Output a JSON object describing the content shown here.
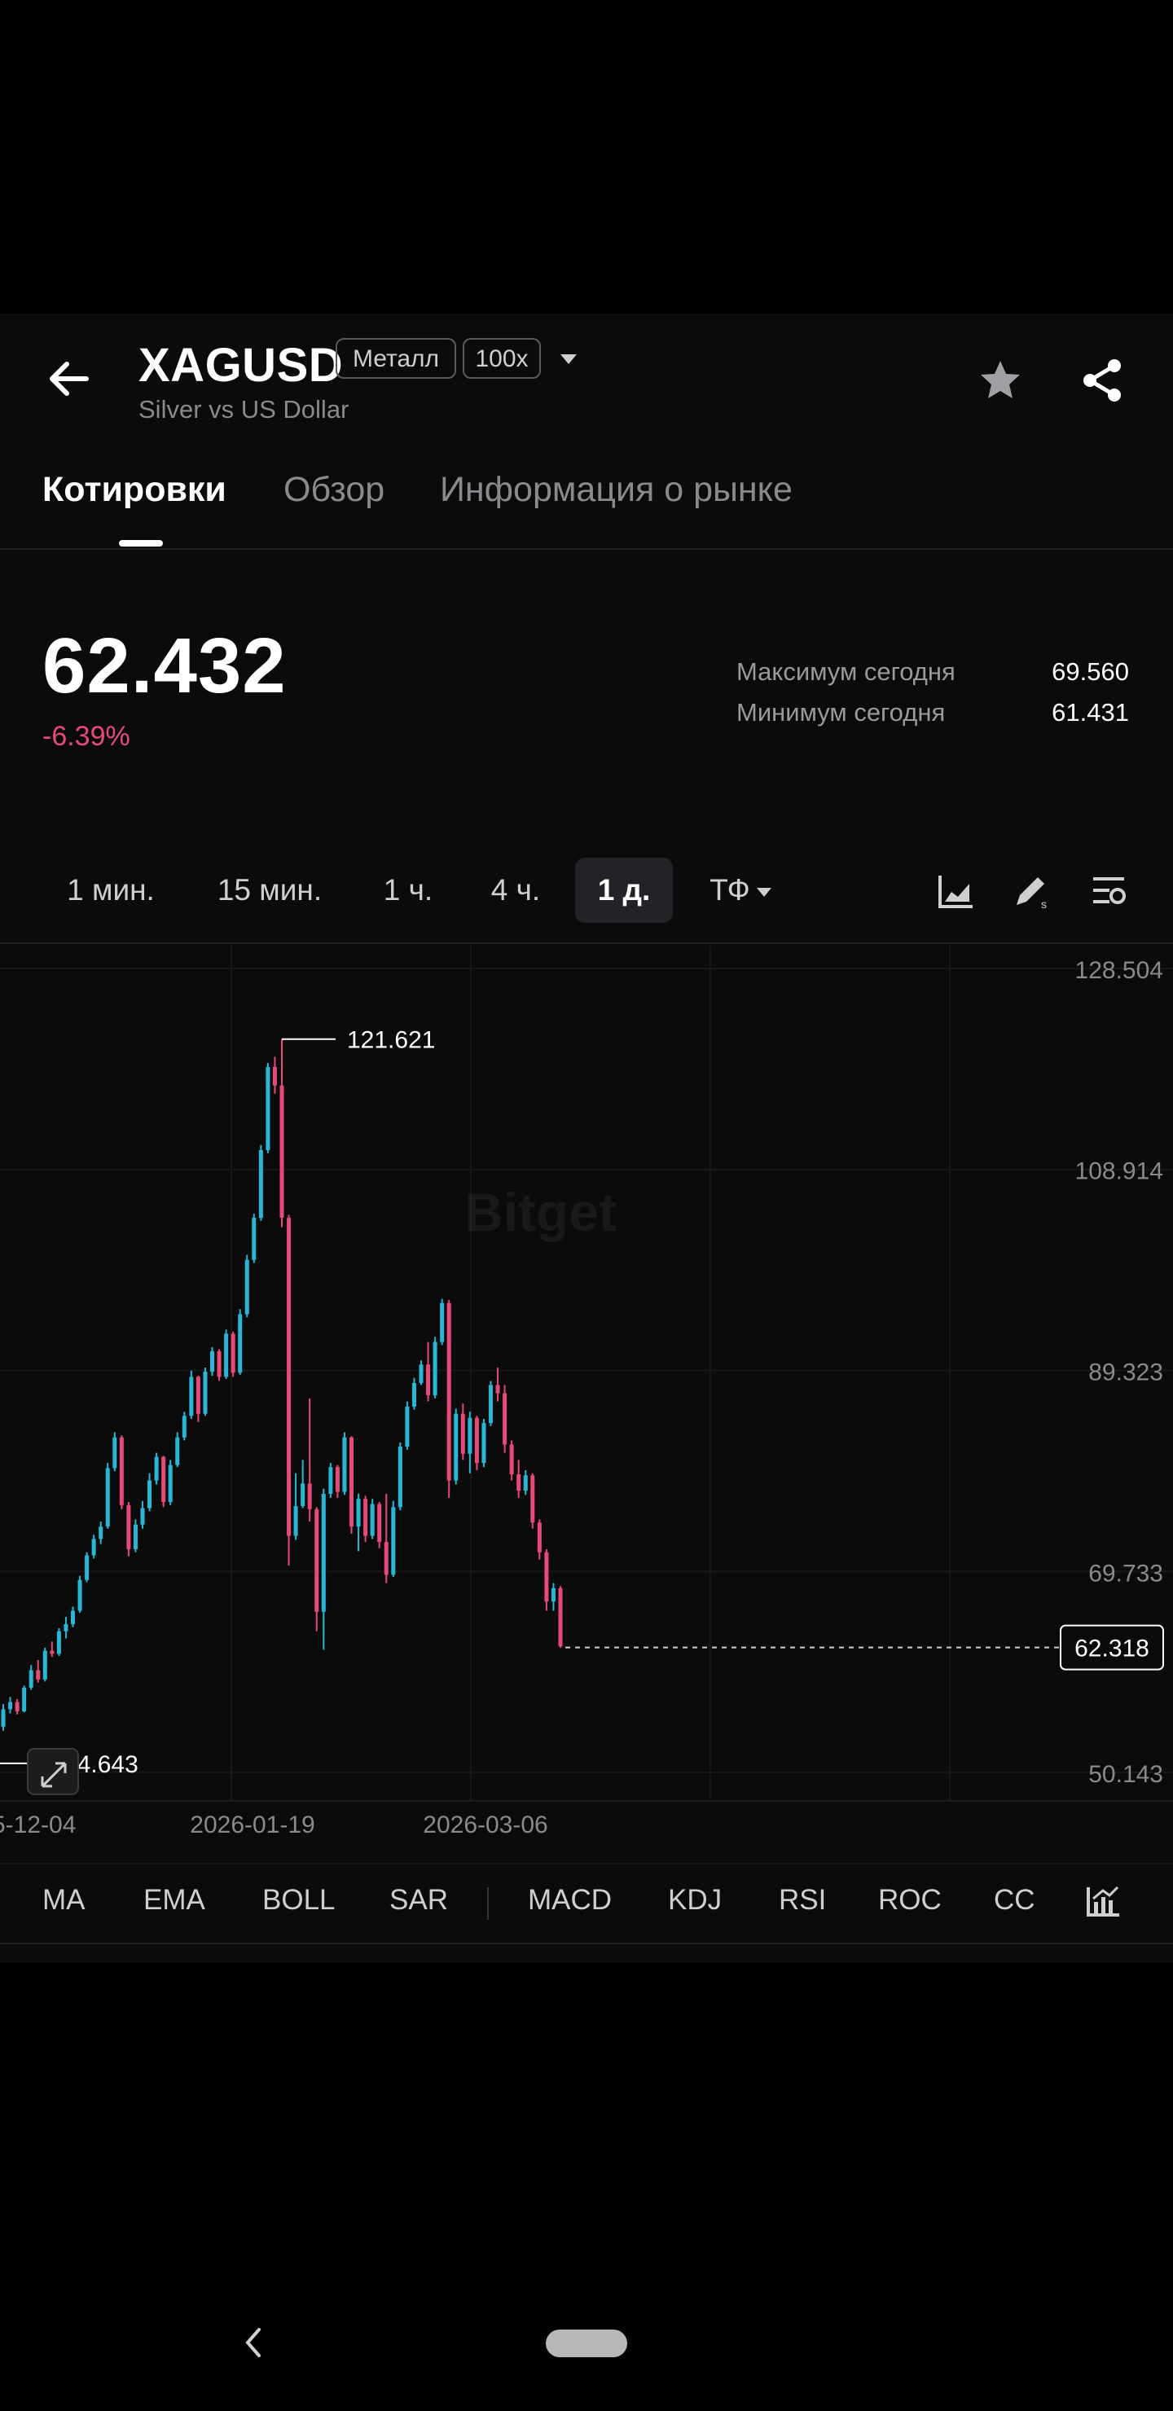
{
  "header": {
    "symbol": "XAGUSD",
    "tag_category": "Металл",
    "tag_leverage": "100x",
    "subtitle": "Silver vs US Dollar"
  },
  "tabs": [
    {
      "label": "Котировки",
      "active": true
    },
    {
      "label": "Обзор",
      "active": false
    },
    {
      "label": "Информация о рынке",
      "active": false
    }
  ],
  "quote": {
    "price": "62.432",
    "change": "-6.39%",
    "high_label": "Максимум сегодня",
    "high_value": "69.560",
    "low_label": "Минимум сегодня",
    "low_value": "61.431"
  },
  "timeframes": [
    {
      "label": "1 мин.",
      "active": false
    },
    {
      "label": "15 мин.",
      "active": false
    },
    {
      "label": "1 ч.",
      "active": false
    },
    {
      "label": "4 ч.",
      "active": false
    },
    {
      "label": "1 д.",
      "active": true
    },
    {
      "label": "ТФ",
      "active": false
    }
  ],
  "tools": [
    "chart-type-icon",
    "draw-icon",
    "chart-settings-icon"
  ],
  "indicators": [
    "MA",
    "EMA",
    "BOLL",
    "SAR",
    "MACD",
    "KDJ",
    "RSI",
    "ROC",
    "CC"
  ],
  "colors": {
    "up": "#2ab7d6",
    "down": "#e64a78",
    "background": "#0b0b0c"
  },
  "chart_data": {
    "type": "candlestick",
    "watermark": "Bitget",
    "ylim": [
      50.143,
      128.504
    ],
    "y_ticks": [
      "128.504",
      "108.914",
      "89.323",
      "69.733",
      "50.143"
    ],
    "x_ticks": [
      "5-12-04",
      "2026-01-19",
      "2026-03-06"
    ],
    "max_label": "121.621",
    "min_label": "54.643",
    "last_price_label": "62.318",
    "last_price": 62.318,
    "ohlc": [
      [
        54.6,
        56.8,
        54.2,
        56.3
      ],
      [
        56.3,
        57.5,
        55.9,
        57.0
      ],
      [
        57.0,
        57.3,
        55.8,
        56.1
      ],
      [
        56.1,
        58.6,
        56.0,
        58.4
      ],
      [
        58.4,
        60.6,
        58.2,
        60.1
      ],
      [
        60.1,
        61.1,
        58.9,
        59.2
      ],
      [
        59.2,
        62.3,
        59.0,
        62.0
      ],
      [
        62.0,
        62.9,
        61.4,
        61.7
      ],
      [
        61.7,
        64.2,
        61.5,
        63.9
      ],
      [
        63.9,
        65.3,
        63.2,
        64.6
      ],
      [
        64.6,
        66.3,
        64.3,
        65.9
      ],
      [
        65.9,
        69.3,
        65.7,
        68.9
      ],
      [
        68.9,
        71.6,
        68.7,
        71.3
      ],
      [
        71.3,
        73.3,
        71.0,
        72.9
      ],
      [
        72.9,
        74.6,
        72.4,
        74.1
      ],
      [
        74.1,
        80.3,
        73.9,
        79.8
      ],
      [
        79.8,
        83.3,
        79.5,
        82.8
      ],
      [
        82.8,
        83.0,
        75.8,
        76.2
      ],
      [
        76.2,
        76.5,
        71.2,
        71.9
      ],
      [
        71.9,
        74.8,
        71.6,
        74.3
      ],
      [
        74.3,
        76.6,
        73.9,
        75.9
      ],
      [
        75.9,
        79.3,
        75.6,
        78.6
      ],
      [
        78.6,
        81.3,
        78.2,
        80.9
      ],
      [
        80.9,
        81.0,
        76.0,
        76.5
      ],
      [
        76.5,
        80.6,
        76.2,
        80.1
      ],
      [
        80.1,
        83.3,
        79.9,
        82.8
      ],
      [
        82.8,
        85.3,
        82.5,
        84.9
      ],
      [
        84.9,
        89.3,
        84.6,
        88.7
      ],
      [
        88.7,
        88.8,
        84.3,
        85.1
      ],
      [
        85.1,
        89.6,
        84.9,
        89.2
      ],
      [
        89.2,
        91.6,
        88.8,
        91.2
      ],
      [
        91.2,
        91.4,
        88.3,
        88.7
      ],
      [
        88.7,
        93.3,
        88.5,
        92.9
      ],
      [
        92.9,
        93.1,
        88.7,
        89.1
      ],
      [
        89.1,
        95.3,
        88.9,
        94.8
      ],
      [
        94.8,
        100.6,
        94.5,
        100.1
      ],
      [
        100.1,
        104.6,
        99.8,
        104.2
      ],
      [
        104.2,
        111.3,
        103.9,
        110.8
      ],
      [
        110.8,
        119.3,
        110.5,
        118.9
      ],
      [
        118.9,
        119.9,
        116.3,
        117.1
      ],
      [
        117.1,
        121.621,
        103.3,
        104.2
      ],
      [
        104.2,
        104.5,
        70.3,
        73.2
      ],
      [
        73.2,
        79.3,
        72.8,
        76.1
      ],
      [
        76.1,
        80.6,
        75.9,
        78.3
      ],
      [
        78.3,
        86.6,
        74.6,
        75.8
      ],
      [
        75.8,
        76.0,
        63.9,
        65.8
      ],
      [
        65.8,
        77.8,
        62.1,
        77.3
      ],
      [
        77.3,
        80.3,
        76.9,
        79.9
      ],
      [
        79.9,
        80.1,
        76.9,
        77.5
      ],
      [
        77.5,
        83.3,
        77.2,
        82.8
      ],
      [
        82.8,
        82.9,
        73.4,
        74.1
      ],
      [
        74.1,
        77.3,
        71.7,
        76.8
      ],
      [
        76.8,
        77.1,
        72.6,
        73.2
      ],
      [
        73.2,
        76.8,
        72.9,
        76.3
      ],
      [
        76.3,
        76.5,
        72.0,
        72.6
      ],
      [
        72.6,
        77.3,
        68.6,
        69.4
      ],
      [
        69.4,
        76.6,
        69.2,
        76.0
      ],
      [
        76.0,
        82.3,
        75.7,
        81.9
      ],
      [
        81.9,
        86.3,
        81.6,
        85.8
      ],
      [
        85.8,
        88.6,
        85.5,
        88.1
      ],
      [
        88.1,
        90.3,
        87.9,
        89.9
      ],
      [
        89.9,
        92.1,
        86.3,
        86.9
      ],
      [
        86.9,
        92.6,
        86.6,
        92.1
      ],
      [
        92.1,
        96.3,
        91.8,
        95.9
      ],
      [
        95.9,
        96.2,
        76.9,
        78.6
      ],
      [
        78.6,
        85.6,
        78.2,
        85.1
      ],
      [
        85.1,
        86.1,
        80.6,
        81.2
      ],
      [
        81.2,
        85.3,
        79.3,
        84.7
      ],
      [
        84.7,
        84.9,
        79.6,
        80.3
      ],
      [
        80.3,
        84.6,
        79.9,
        84.2
      ],
      [
        84.2,
        88.3,
        83.9,
        87.9
      ],
      [
        87.9,
        89.6,
        86.3,
        87.1
      ],
      [
        87.1,
        87.9,
        81.3,
        82.1
      ],
      [
        82.1,
        82.5,
        78.6,
        79.2
      ],
      [
        79.2,
        80.6,
        76.9,
        77.6
      ],
      [
        77.6,
        79.6,
        77.2,
        79.1
      ],
      [
        79.1,
        79.3,
        73.9,
        74.5
      ],
      [
        74.5,
        74.8,
        70.9,
        71.6
      ],
      [
        71.6,
        71.9,
        65.9,
        66.8
      ],
      [
        66.8,
        68.6,
        65.9,
        68.1
      ],
      [
        68.1,
        68.3,
        62.3,
        62.432
      ]
    ]
  }
}
